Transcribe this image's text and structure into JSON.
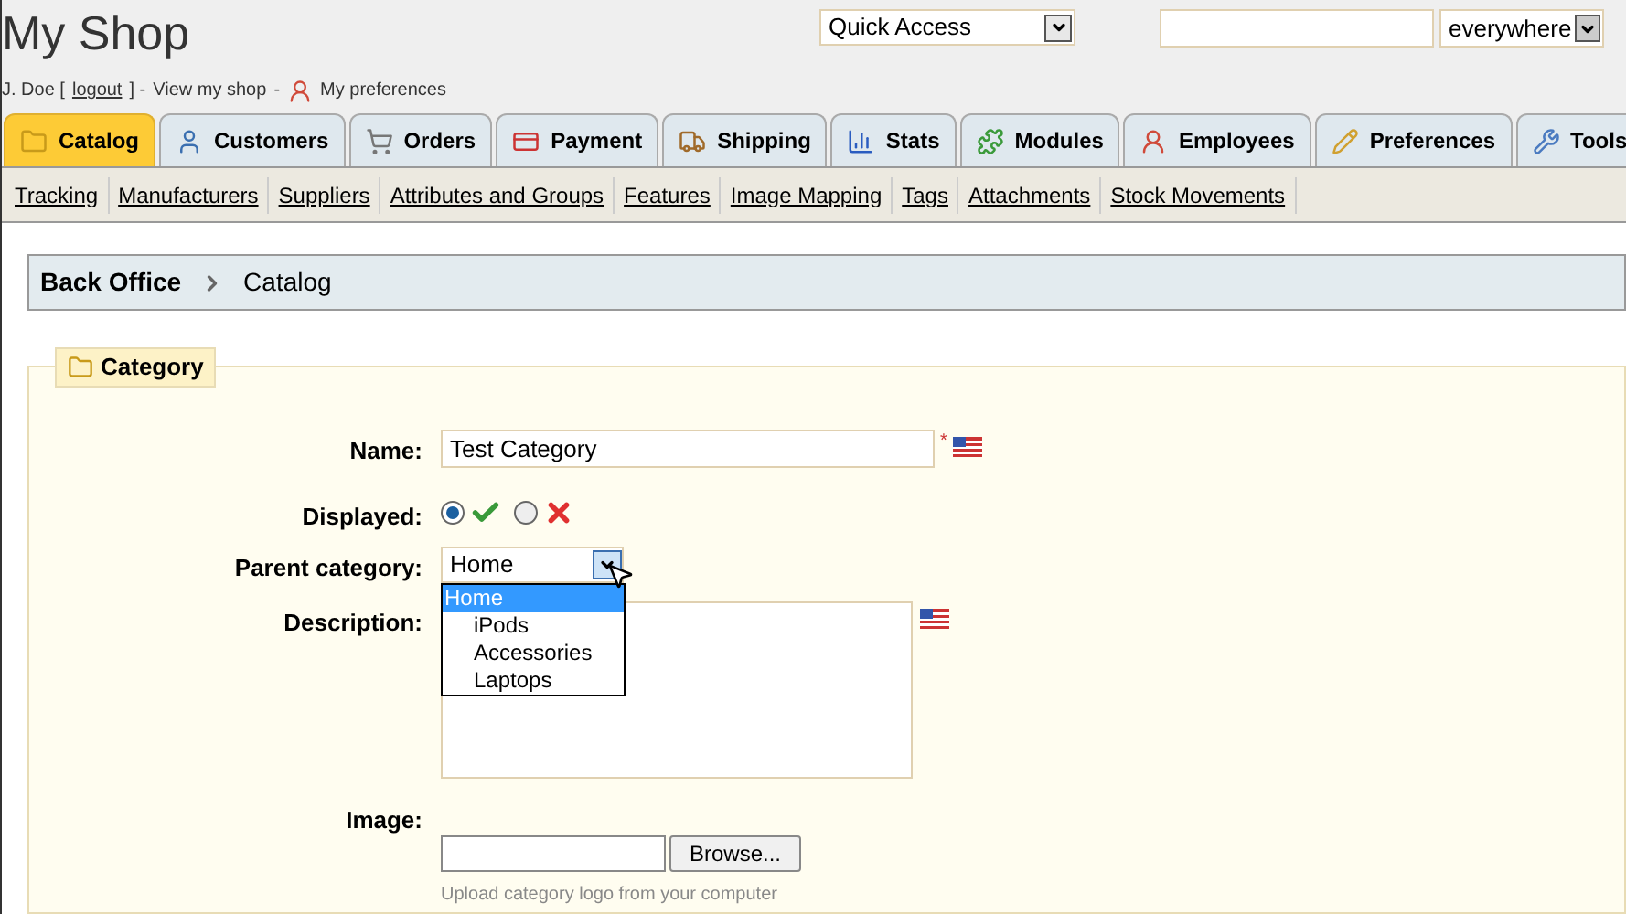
{
  "header": {
    "shop_title": "My Shop",
    "user_name": "J. Doe [",
    "logout_link": "logout",
    "user_sep": "] -",
    "view_shop_link": "View my shop",
    "view_sep": "-",
    "preferences_link": "My preferences",
    "quick_access": {
      "value": "Quick Access"
    },
    "search": {
      "scope": "everywhere"
    }
  },
  "tabs": [
    {
      "label": "Catalog",
      "selected": true
    },
    {
      "label": "Customers",
      "selected": false
    },
    {
      "label": "Orders",
      "selected": false
    },
    {
      "label": "Payment",
      "selected": false
    },
    {
      "label": "Shipping",
      "selected": false
    },
    {
      "label": "Stats",
      "selected": false
    },
    {
      "label": "Modules",
      "selected": false
    },
    {
      "label": "Employees",
      "selected": false
    },
    {
      "label": "Preferences",
      "selected": false
    },
    {
      "label": "Tools",
      "selected": false
    }
  ],
  "subnav": [
    "Tracking",
    "Manufacturers",
    "Suppliers",
    "Attributes and Groups",
    "Features",
    "Image Mapping",
    "Tags",
    "Attachments",
    "Stock Movements"
  ],
  "breadcrumb": [
    "Back Office",
    "Catalog"
  ],
  "form": {
    "legend": "Category",
    "name": {
      "label": "Name:",
      "value": "Test Category",
      "required_mark": "*"
    },
    "displayed": {
      "label": "Displayed:",
      "options": [
        {
          "kind": "yes",
          "selected": true
        },
        {
          "kind": "no",
          "selected": false
        }
      ]
    },
    "parent": {
      "label": "Parent category:",
      "value": "Home",
      "expanded": true,
      "options": [
        {
          "label": "Home",
          "selected": true,
          "children": [
            {
              "label": "iPods",
              "selected": false
            },
            {
              "label": "Accessories",
              "selected": false
            },
            {
              "label": "Laptops",
              "selected": false
            }
          ]
        }
      ]
    },
    "description": {
      "label": "Description:"
    },
    "image": {
      "label": "Image:",
      "button": "Browse...",
      "hint": "Upload category logo from your computer"
    }
  }
}
